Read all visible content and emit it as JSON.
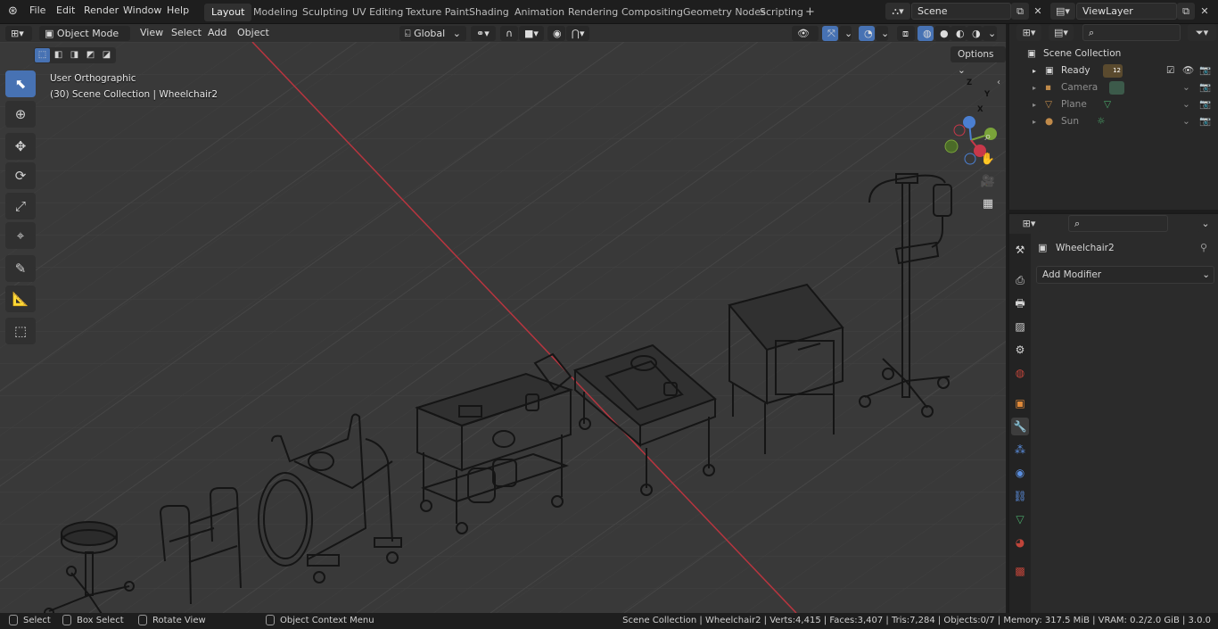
{
  "menu": [
    "File",
    "Edit",
    "Render",
    "Window",
    "Help"
  ],
  "workspaces": [
    "Layout",
    "Modeling",
    "Sculpting",
    "UV Editing",
    "Texture Paint",
    "Shading",
    "Animation",
    "Rendering",
    "Compositing",
    "Geometry Nodes",
    "Scripting"
  ],
  "active_workspace": "Layout",
  "add_workspace": "+",
  "scene_name": "Scene",
  "view_layer": "ViewLayer",
  "viewport_header": {
    "mode": "Object Mode",
    "menus": [
      "View",
      "Select",
      "Add",
      "Object"
    ],
    "orientation": "Global",
    "options_label": "Options"
  },
  "viewport_info": {
    "view_name": "User Orthographic",
    "collection_line": "(30) Scene Collection | Wheelchair2"
  },
  "gizmo": {
    "x": "X",
    "y": "Y",
    "z": "Z"
  },
  "outliner": {
    "root": "Scene Collection",
    "items": [
      {
        "name": "Ready",
        "badge": "12"
      },
      {
        "name": "Camera"
      },
      {
        "name": "Plane"
      },
      {
        "name": "Sun"
      }
    ]
  },
  "properties": {
    "object_name": "Wheelchair2",
    "add_modifier": "Add Modifier"
  },
  "statusbar": {
    "left": [
      "Select",
      "Box Select",
      "Rotate View",
      "Object Context Menu"
    ],
    "right": "Scene Collection | Wheelchair2 | Verts:4,415 | Faces:3,407 | Tris:7,284 | Objects:0/7 | Memory: 317.5 MiB | VRAM: 0.2/2.0 GiB | 3.0.0"
  },
  "colors": {
    "accent": "#4772b3",
    "x_axis": "#c8384a",
    "y_axis": "#7aa33a",
    "z_axis": "#4b7fd1"
  }
}
